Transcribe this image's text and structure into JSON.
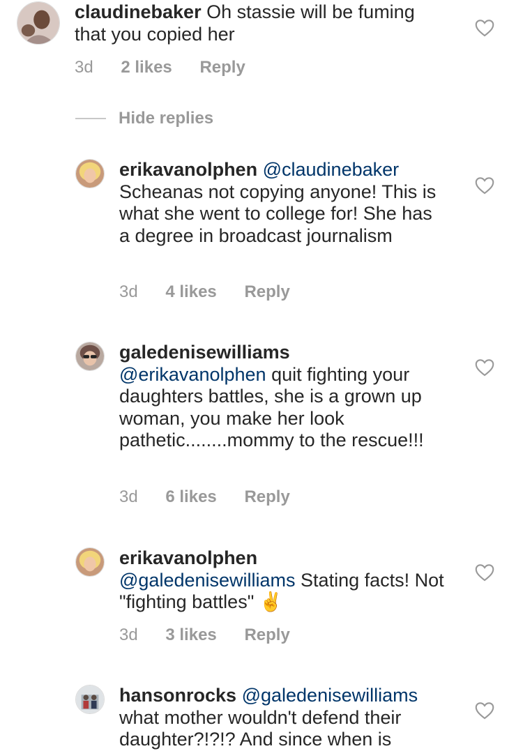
{
  "comments": [
    {
      "username": "claudinebaker",
      "mention": "",
      "text": "Oh stassie will be fuming that you copied her",
      "time": "3d",
      "likes": "2 likes",
      "reply": "Reply",
      "emoji": ""
    },
    {
      "username": "erikavanolphen",
      "mention": "@claudinebaker",
      "text": "Scheanas not copying anyone! This is what she went to college for! She has a degree in broadcast journalism",
      "time": "3d",
      "likes": "4 likes",
      "reply": "Reply",
      "emoji": ""
    },
    {
      "username": "galedenisewilliams",
      "mention": "@erikavanolphen",
      "text": "quit fighting your daughters battles, she is a grown up woman, you make her look pathetic........mommy to the rescue!!!",
      "time": "3d",
      "likes": "6 likes",
      "reply": "Reply",
      "emoji": ""
    },
    {
      "username": "erikavanolphen",
      "mention": "@galedenisewilliams",
      "text": "Stating facts! Not \"fighting battles\"",
      "time": "3d",
      "likes": "3 likes",
      "reply": "Reply",
      "emoji": "✌"
    },
    {
      "username": "hansonrocks",
      "mention": "@galedenisewilliams",
      "text": "what mother wouldn't defend their daughter?!?!? And since when is",
      "time": "",
      "likes": "",
      "reply": "",
      "emoji": ""
    }
  ],
  "hide_replies": "Hide replies",
  "icons": {
    "like": "heart-outline-icon"
  },
  "colors": {
    "mention": "#003569",
    "meta": "#999999",
    "text": "#262626"
  }
}
